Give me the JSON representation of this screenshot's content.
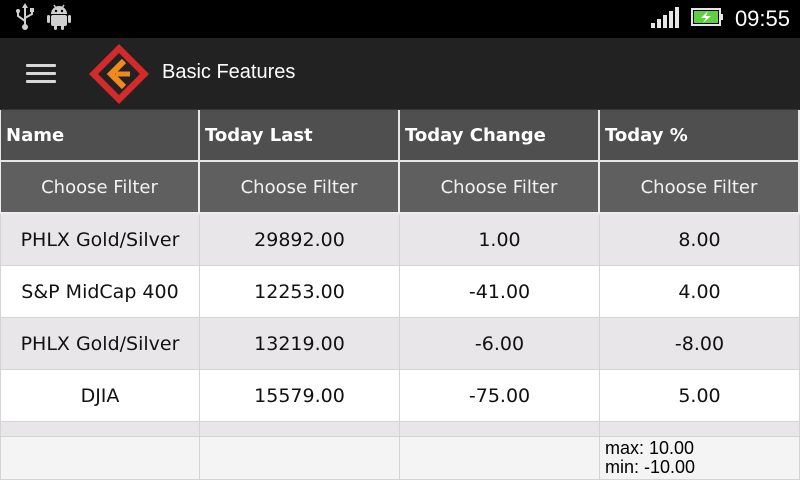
{
  "status_bar": {
    "left_icons": [
      "usb-icon",
      "android-debug-icon"
    ],
    "right_icons": [
      "signal-icon",
      "battery-charging-icon"
    ],
    "time": "09:55"
  },
  "action_bar": {
    "menu_icon": "hamburger-menu-icon",
    "logo_icon": "app-logo-icon",
    "title": "Basic Features",
    "logo_colors": {
      "outer": "#d42a2a",
      "inner": "#f08a1c"
    }
  },
  "grid": {
    "columns": [
      "Name",
      "Today Last",
      "Today Change",
      "Today %"
    ],
    "filters": [
      "Choose Filter",
      "Choose Filter",
      "Choose Filter",
      "Choose Filter"
    ],
    "rows": [
      [
        "PHLX Gold/Silver",
        "29892.00",
        "1.00",
        "8.00"
      ],
      [
        "S&P MidCap 400",
        "12253.00",
        "-41.00",
        "4.00"
      ],
      [
        "PHLX Gold/Silver",
        "13219.00",
        "-6.00",
        "-8.00"
      ],
      [
        "DJIA",
        "15579.00",
        "-75.00",
        "5.00"
      ]
    ],
    "summary": {
      "max": "max: 10.00",
      "min": "min: -10.00"
    }
  }
}
